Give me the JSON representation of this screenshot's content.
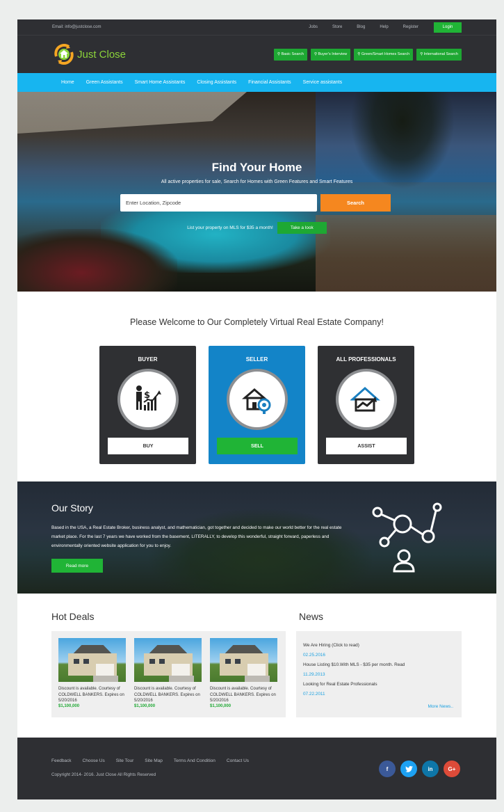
{
  "topbar": {
    "email": "Email: info@justclose.com",
    "links": [
      "Jobs",
      "Store",
      "Blog",
      "Help",
      "Register"
    ],
    "login": "Login"
  },
  "header": {
    "logo_text": "Just Close",
    "quick_buttons": [
      "Basic Search",
      "Buyer's Interview",
      "Green/Smart Homes Search",
      "International Search"
    ]
  },
  "nav": [
    "Home",
    "Green Assistants",
    "Smart Home Assistants",
    "Closing Assistants",
    "Financial Assistants",
    "Service assistants"
  ],
  "hero": {
    "title": "Find Your Home",
    "subtitle": "All active properties for sale, Search for Homes with Green Features and Smart Features",
    "search_placeholder": "Enter Location, Zipcode",
    "search_button": "Search",
    "mls_text": "List your property on MLS for $35 a month!",
    "mls_button": "Take a look"
  },
  "welcome": "Please Welcome to Our Completely Virtual Real Estate Company!",
  "cards": [
    {
      "title": "BUYER",
      "button": "BUY"
    },
    {
      "title": "SELLER",
      "button": "SELL"
    },
    {
      "title": "ALL PROFESSIONALS",
      "button": "ASSIST"
    }
  ],
  "story": {
    "title": "Our Story",
    "text": "Based in the USA, a Real Estate Broker, business analyst, and mathematician, got together and decided to make our world better for the real estate market place. For the last 7 years we have worked from the basement, LITERALLY, to develop this wonderful, straight forward, paperless and environmentally oriented website application for you to enjoy.",
    "button": "Read more"
  },
  "deals": {
    "title": "Hot Deals",
    "items": [
      {
        "text": "Discount is available. Courtesy of COLDWELL BANKERS. Expires on 5/20/2016",
        "price": "$1,100,000"
      },
      {
        "text": "Discount is available. Courtesy of COLDWELL BANKERS. Expires on 5/20/2016",
        "price": "$1,100,000"
      },
      {
        "text": "Discount is available. Courtesy of COLDWELL BANKERS. Expires on 5/20/2016",
        "price": "$1,100,000"
      }
    ]
  },
  "news": {
    "title": "News",
    "items": [
      {
        "text": "We Are Hiring (Click to read)",
        "date": "02.25.2016"
      },
      {
        "text": "House Listing $10.With MLS - $35 per month. Read",
        "date": "11.29.2013"
      },
      {
        "text": "Looking for Real Estate Professionals",
        "date": "07.22.2011"
      }
    ],
    "more": "More News.."
  },
  "footer": {
    "links": [
      "Feedback",
      "Choose Us",
      "Site Tour",
      "Site Map",
      "Terms And Condition",
      "Contact Us"
    ],
    "copyright": "Copyright 2014- 2016. Just Close All Rights Reserved",
    "social": [
      {
        "label": "f",
        "color": "#3b5998",
        "icon": "facebook-icon"
      },
      {
        "label": "t",
        "color": "#1da1f2",
        "icon": "twitter-icon"
      },
      {
        "label": "in",
        "color": "#0e76a8",
        "icon": "linkedin-icon"
      },
      {
        "label": "G+",
        "color": "#dd4b39",
        "icon": "google-plus-icon"
      }
    ]
  },
  "colors": {
    "accent_green": "#20b436",
    "nav_blue": "#17b5f0",
    "search_orange": "#f5871f",
    "dark": "#2e2f33"
  }
}
